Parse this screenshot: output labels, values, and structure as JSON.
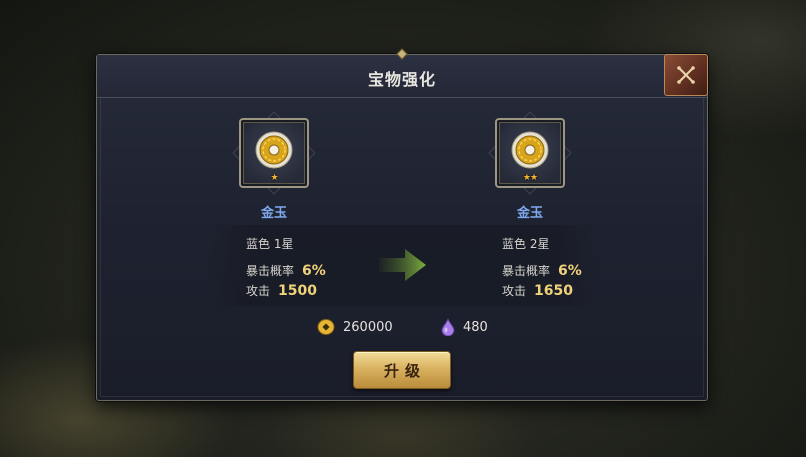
{
  "dialog": {
    "title": "宝物强化",
    "close_icon": "close-crossed-swords-icon",
    "accent_color": "#f0d27a"
  },
  "current": {
    "name": "金玉",
    "stars": "★",
    "grade": "蓝色 1星",
    "crit_label": "暴击概率",
    "crit_value": "6%",
    "attack_label": "攻击",
    "attack_value": "1500"
  },
  "next": {
    "name": "金玉",
    "stars": "★★",
    "grade": "蓝色 2星",
    "crit_label": "暴击概率",
    "crit_value": "6%",
    "attack_label": "攻击",
    "attack_value": "1650"
  },
  "cost": {
    "gold_icon": "gold-coin-icon",
    "gold_amount": "260000",
    "essence_icon": "purple-drop-icon",
    "essence_amount": "480"
  },
  "actions": {
    "upgrade_label": "升级"
  }
}
